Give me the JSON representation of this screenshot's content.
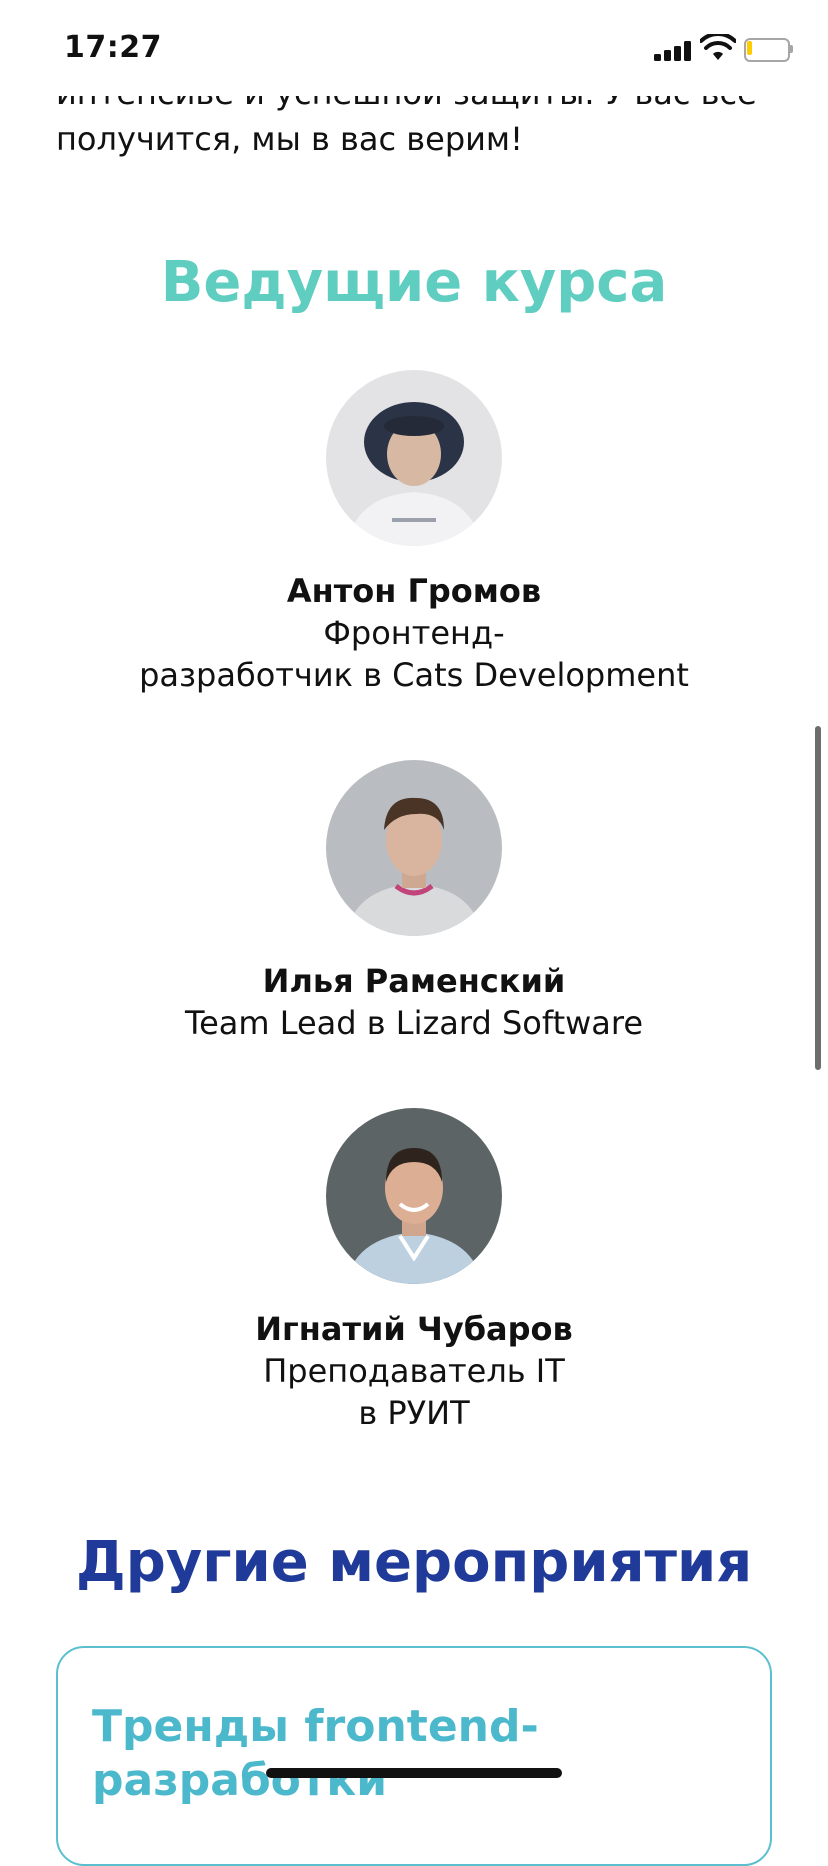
{
  "status_bar": {
    "time": "17:27"
  },
  "intro": {
    "cropped_line": "интенсиве и успешной защиты. У вас все",
    "last_line": "получится, мы в вас верим!"
  },
  "hosts": {
    "title": "Ведущие курса",
    "speakers": [
      {
        "name": "Антон Громов",
        "role": "Фронтенд-\nразработчик в Cats Development"
      },
      {
        "name": "Илья Раменский",
        "role": "Team Lead в Lizard Software"
      },
      {
        "name": "Игнатий Чубаров",
        "role": "Преподаватель IT\nв РУИТ"
      }
    ]
  },
  "events": {
    "title": "Другие мероприятия",
    "card_title": "Тренды frontend-разработки"
  },
  "colors": {
    "hosts_title": "#5fcdc0",
    "events_title": "#1f3a98",
    "card_border": "#5bbfd0",
    "card_title": "#4bb8cc"
  }
}
